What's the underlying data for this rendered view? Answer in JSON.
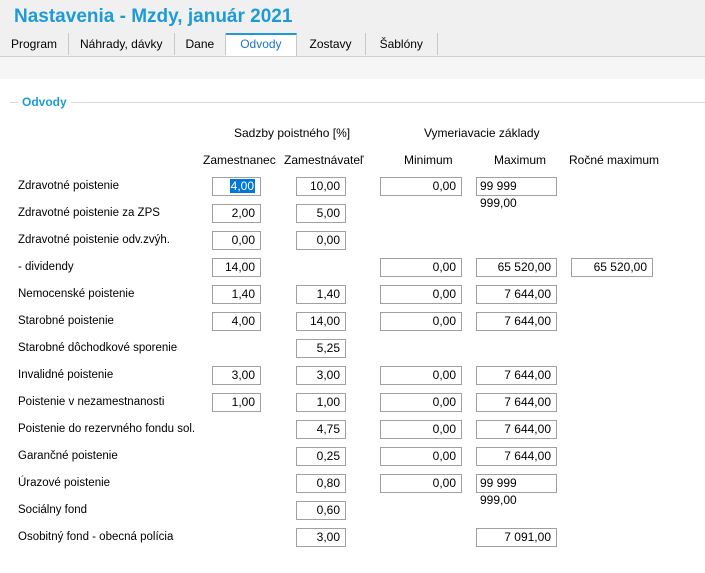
{
  "window": {
    "title": "Nastavenia - Mzdy, január 2021"
  },
  "tabs": [
    {
      "label": "Program"
    },
    {
      "label": "Náhrady, dávky"
    },
    {
      "label": "Dane"
    },
    {
      "label": "Odvody"
    },
    {
      "label": "Zostavy"
    },
    {
      "label": "Šablóny"
    }
  ],
  "active_tab": "Odvody",
  "group": {
    "title": "Odvody"
  },
  "headers": {
    "rates": "Sadzby poistného [%]",
    "bases": "Vymeriavacie základy",
    "employee": "Zamestnanec",
    "employer": "Zamestnávateľ",
    "minimum": "Minimum",
    "maximum": "Maximum",
    "annual_max": "Ročné maximum"
  },
  "rows": [
    {
      "label": "Zdravotné poistenie",
      "employee": "4,00",
      "employer": "10,00",
      "minimum": "0,00",
      "maximum": "99 999 999,00"
    },
    {
      "label": "Zdravotné poistenie za ZPS",
      "employee": "2,00",
      "employer": "5,00"
    },
    {
      "label": "Zdravotné poistenie odv.zvýh.",
      "employee": "0,00",
      "employer": "0,00"
    },
    {
      "label": "- dividendy",
      "employee": "14,00",
      "minimum": "0,00",
      "maximum": "65 520,00",
      "annual_max": "65 520,00"
    },
    {
      "label": "Nemocenské poistenie",
      "employee": "1,40",
      "employer": "1,40",
      "minimum": "0,00",
      "maximum": "7 644,00"
    },
    {
      "label": "Starobné poistenie",
      "employee": "4,00",
      "employer": "14,00",
      "minimum": "0,00",
      "maximum": "7 644,00"
    },
    {
      "label": "Starobné dôchodkové sporenie",
      "employer": "5,25"
    },
    {
      "label": "Invalidné poistenie",
      "employee": "3,00",
      "employer": "3,00",
      "minimum": "0,00",
      "maximum": "7 644,00"
    },
    {
      "label": "Poistenie v nezamestnanosti",
      "employee": "1,00",
      "employer": "1,00",
      "minimum": "0,00",
      "maximum": "7 644,00"
    },
    {
      "label": "Poistenie do rezervného fondu sol.",
      "employer": "4,75",
      "minimum": "0,00",
      "maximum": "7 644,00"
    },
    {
      "label": "Garančné poistenie",
      "employer": "0,25",
      "minimum": "0,00",
      "maximum": "7 644,00"
    },
    {
      "label": "Úrazové poistenie",
      "employer": "0,80",
      "minimum": "0,00",
      "maximum": "99 999 999,00"
    },
    {
      "label": "Sociálny fond",
      "employer": "0,60"
    },
    {
      "label": "Osobitný fond - obecná polícia",
      "employer": "3,00",
      "maximum": "7 091,00"
    }
  ]
}
